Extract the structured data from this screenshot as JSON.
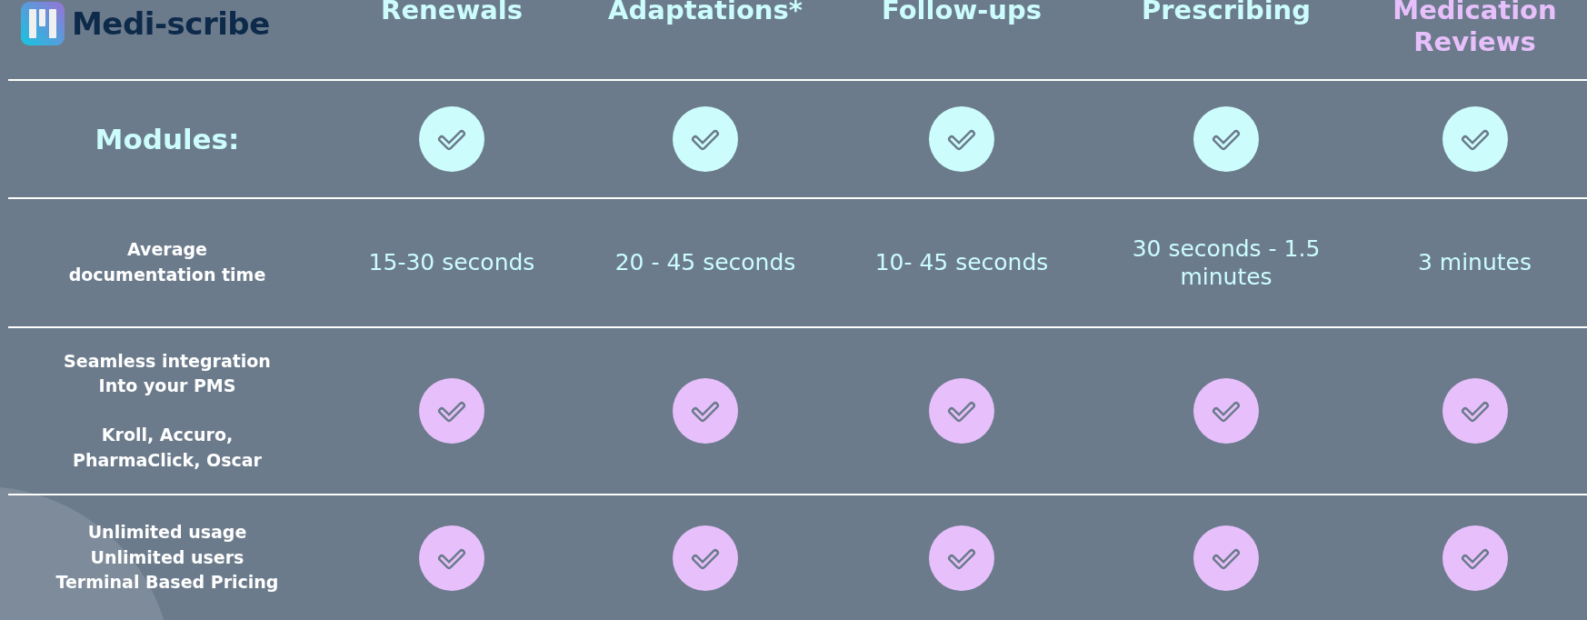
{
  "logo": {
    "name": "Medi-scribe"
  },
  "columns": [
    {
      "label": "Renewals",
      "color": "#ccfdfc"
    },
    {
      "label": "Adaptations*",
      "color": "#ccfdfc"
    },
    {
      "label": "Follow-ups",
      "color": "#ccfdfc"
    },
    {
      "label": "Prescribing",
      "color": "#ccfdfc"
    },
    {
      "label": "Medication Reviews",
      "color": "#e7c0fb"
    }
  ],
  "rows": [
    {
      "kind": "checks",
      "heading": true,
      "label": [
        "Modules:"
      ],
      "color": "#ccfdfc",
      "cells": [
        {
          "checked": true
        },
        {
          "checked": true
        },
        {
          "checked": true
        },
        {
          "checked": true
        },
        {
          "checked": true
        }
      ]
    },
    {
      "kind": "text",
      "heading": false,
      "label": [
        "Average documentation time"
      ],
      "cells": [
        "15-30 seconds",
        "20 - 45 seconds",
        "10- 45 seconds",
        "30 seconds - 1.5 minutes",
        "3 minutes"
      ]
    },
    {
      "kind": "checks",
      "heading": false,
      "label": [
        "Seamless integration Into your PMS",
        "Kroll, Accuro, PharmaClick, Oscar"
      ],
      "color": "#e7c0fb",
      "cells": [
        {
          "checked": true
        },
        {
          "checked": true
        },
        {
          "checked": true
        },
        {
          "checked": true
        },
        {
          "checked": true
        }
      ]
    },
    {
      "kind": "checks",
      "heading": false,
      "label": [
        "Unlimited usage",
        "Unlimited users",
        "Terminal Based Pricing"
      ],
      "color": "#e7c0fb",
      "cells": [
        {
          "checked": true
        },
        {
          "checked": true
        },
        {
          "checked": true
        },
        {
          "checked": true
        },
        {
          "checked": true
        }
      ]
    }
  ]
}
